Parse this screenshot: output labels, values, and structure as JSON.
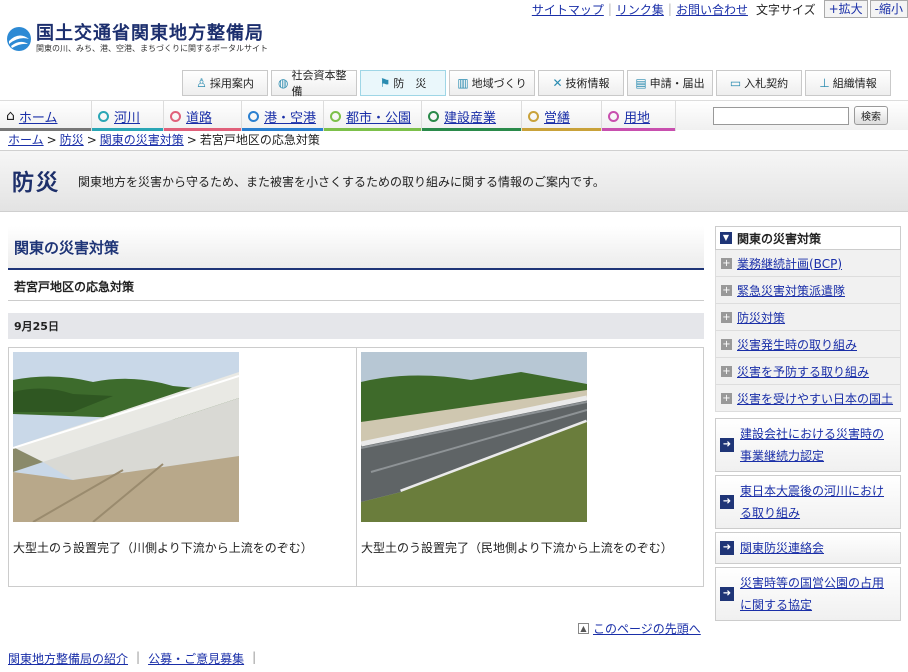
{
  "utility": {
    "links": [
      "サイトマップ",
      "リンク集",
      "お問い合わせ"
    ],
    "font_size_label": "文字サイズ",
    "enlarge": "+拡大",
    "shrink": "-縮小"
  },
  "logo": {
    "title": "国土交通省関東地方整備局",
    "subtitle": "関東の川、みち、港、空港、まちづくりに関するポータルサイト"
  },
  "top_nav": [
    "採用案内",
    "社会資本整備",
    "防　災",
    "地域づくり",
    "技術情報",
    "申請・届出",
    "入札契約",
    "組織情報"
  ],
  "main_nav": [
    "ホーム",
    "河川",
    "道路",
    "港・空港",
    "都市・公園",
    "建設産業",
    "営繕",
    "用地"
  ],
  "main_nav_colors": [
    "#777777",
    "#2aa6b5",
    "#e0607a",
    "#2a7fd0",
    "#7cc04a",
    "#2a8a4a",
    "#c9a23a",
    "#c84fae"
  ],
  "search": {
    "placeholder": "",
    "button": "検索"
  },
  "breadcrumb": [
    "ホーム",
    "防災",
    "関東の災害対策",
    "若宮戸地区の応急対策"
  ],
  "banner": {
    "title": "防災",
    "description": "関東地方を災害から守るため、また被害を小さくするための取り組みに関する情報のご案内です。"
  },
  "content": {
    "heading": "関東の災害対策",
    "subheading": "若宮戸地区の応急対策",
    "date": "9月25日",
    "photos": [
      {
        "caption": "大型土のう設置完了（川側より下流から上流をのぞむ）"
      },
      {
        "caption": "大型土のう設置完了（民地側より下流から上流をのぞむ）"
      }
    ],
    "page_top": "このページの先頭へ"
  },
  "sidebar": {
    "header": "関東の災害対策",
    "items": [
      "業務継続計画(BCP)",
      "緊急災害対策派遣隊",
      "防災対策",
      "災害発生時の取り組み",
      "災害を予防する取り組み",
      "災害を受けやすい日本の国土"
    ],
    "boxes": [
      [
        "建設会社における災害時の",
        "事業継続力認定"
      ],
      [
        "東日本大震後の河川におけ",
        "る取り組み"
      ],
      [
        "関東防災連絡会"
      ],
      [
        "災害時等の国営公園の占用",
        "に関する協定"
      ]
    ]
  },
  "footer": [
    "関東地方整備局の紹介",
    "公募・ご意見募集"
  ]
}
